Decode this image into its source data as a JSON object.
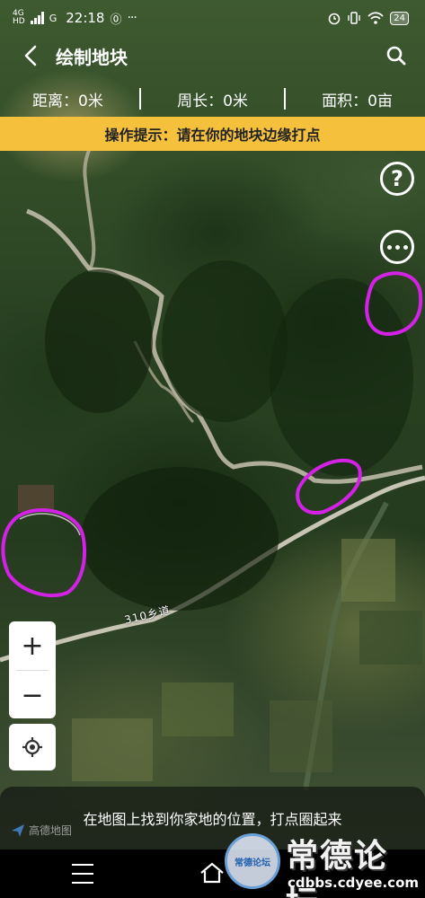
{
  "status_bar": {
    "network": "4G",
    "network_sub": "HD",
    "network2": "G",
    "time": "22:18",
    "notification_badge": "⓪",
    "battery": "24"
  },
  "header": {
    "title": "绘制地块"
  },
  "measure": {
    "distance": "距离：0米",
    "perimeter": "周长：0米",
    "area": "面积：0亩"
  },
  "tip": {
    "text": "操作提示：请在你的地块边缘打点"
  },
  "map": {
    "road_label": "310乡道",
    "logo_text": "高德地图"
  },
  "controls": {
    "zoom_in": "+",
    "zoom_out": "−",
    "help": "?"
  },
  "bottom_hint": {
    "text": "在地图上找到你家地的位置，打点圈起来"
  },
  "watermark": {
    "title": "常德论坛",
    "url": "cdbbs.cdyee.com",
    "seal_text": "常德论坛"
  },
  "colors": {
    "tip_bg": "#f5c13c",
    "plot_outline": "#d322e6"
  }
}
